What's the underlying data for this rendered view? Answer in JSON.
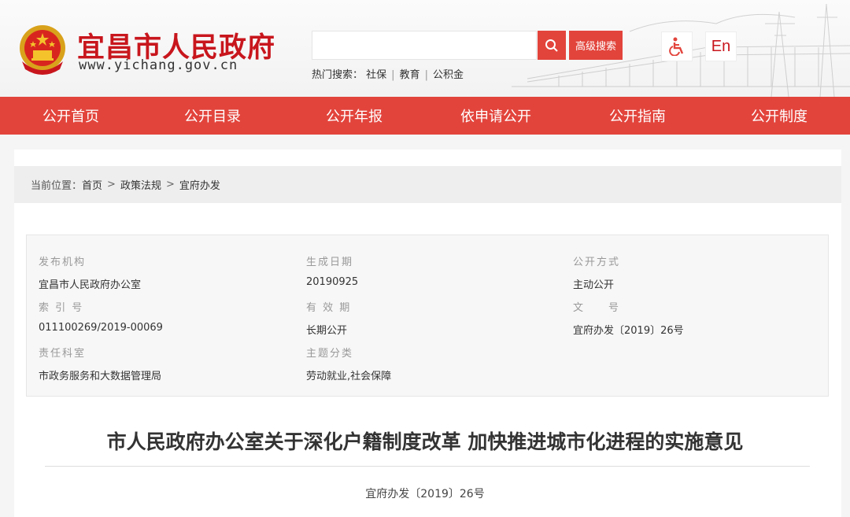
{
  "header": {
    "site_name": "宜昌市人民政府",
    "site_url": "www.yichang.gov.cn",
    "search": {
      "placeholder": "",
      "advanced_label": "高级搜索"
    },
    "hot_search": {
      "label": "热门搜索：",
      "items": [
        "社保",
        "教育",
        "公积金"
      ]
    },
    "lang_label": "En"
  },
  "nav": {
    "items": [
      "公开首页",
      "公开目录",
      "公开年报",
      "依申请公开",
      "公开指南",
      "公开制度"
    ]
  },
  "breadcrumb": {
    "label": "当前位置：",
    "items": [
      "首页",
      "政策法规",
      "宜府办发"
    ]
  },
  "meta": {
    "publisher_label": "发布机构",
    "publisher": "宜昌市人民政府办公室",
    "date_label": "生成日期",
    "date": "20190925",
    "method_label": "公开方式",
    "method": "主动公开",
    "index_label": "索 引 号",
    "index": "011100269/2019-00069",
    "validity_label": "有 效 期",
    "validity": "长期公开",
    "docno_label": "文　　号",
    "docno": "宜府办发〔2019〕26号",
    "office_label": "责任科室",
    "office": "市政务服务和大数据管理局",
    "topic_label": "主题分类",
    "topic": "劳动就业,社会保障"
  },
  "document": {
    "title": "市人民政府办公室关于深化户籍制度改革 加快推进城市化进程的实施意见",
    "number": "宜府办发〔2019〕26号"
  },
  "colors": {
    "brand_red": "#e2443c",
    "title_red": "#c8161d"
  }
}
